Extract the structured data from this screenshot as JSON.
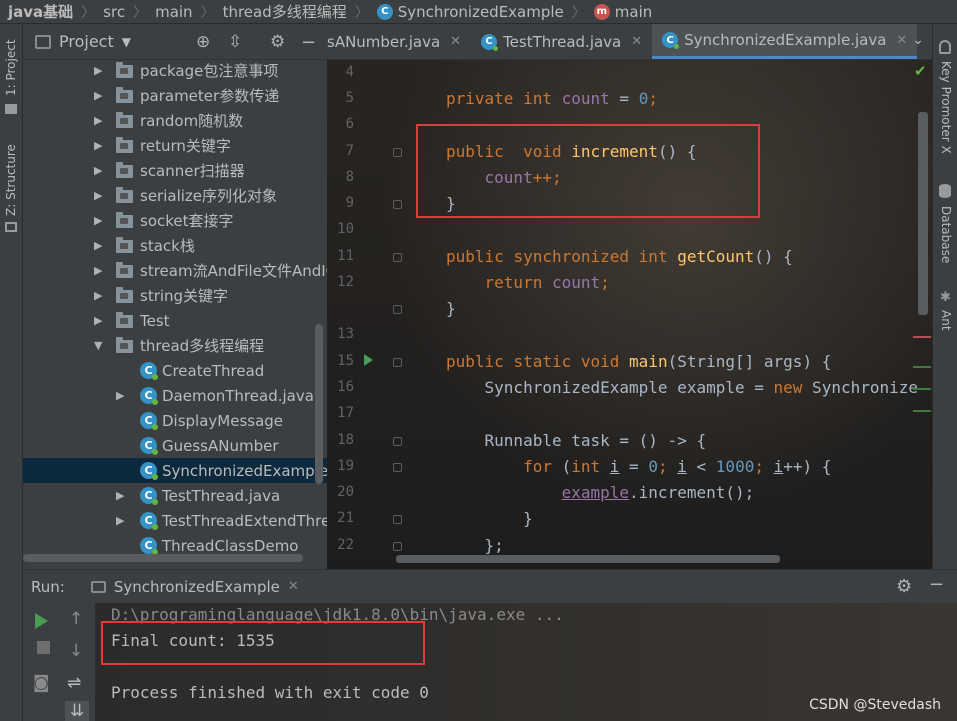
{
  "breadcrumb": {
    "items": [
      "java基础",
      "src",
      "main",
      "thread多线程编程",
      "SynchronizedExample",
      "main"
    ]
  },
  "left_stripe": {
    "project": "1: Project",
    "structure": "Z: Structure"
  },
  "right_stripe": {
    "key_promoter": "Key Promoter X",
    "database": "Database",
    "ant": "Ant"
  },
  "project_panel": {
    "title": "Project",
    "tree": [
      {
        "label": "package包注意事项",
        "type": "folder",
        "expandable": true
      },
      {
        "label": "parameter参数传递",
        "type": "folder",
        "expandable": true
      },
      {
        "label": "random随机数",
        "type": "folder",
        "expandable": true
      },
      {
        "label": "return关键字",
        "type": "folder",
        "expandable": true
      },
      {
        "label": "scanner扫描器",
        "type": "folder",
        "expandable": true
      },
      {
        "label": "serialize序列化对象",
        "type": "folder",
        "expandable": true
      },
      {
        "label": "socket套接字",
        "type": "folder",
        "expandable": true
      },
      {
        "label": "stack栈",
        "type": "folder",
        "expandable": true
      },
      {
        "label": "stream流AndFile文件AndIO",
        "type": "folder",
        "expandable": true
      },
      {
        "label": "string关键字",
        "type": "folder",
        "expandable": true
      },
      {
        "label": "Test",
        "type": "folder",
        "expandable": true
      },
      {
        "label": "thread多线程编程",
        "type": "folder",
        "expanded": true
      },
      {
        "label": "CreateThread",
        "type": "class"
      },
      {
        "label": "DaemonThread.java",
        "type": "class",
        "expandable": true
      },
      {
        "label": "DisplayMessage",
        "type": "class"
      },
      {
        "label": "GuessANumber",
        "type": "class"
      },
      {
        "label": "SynchronizedExample",
        "type": "class",
        "selected": true
      },
      {
        "label": "TestThread.java",
        "type": "class",
        "expandable": true
      },
      {
        "label": "TestThreadExtendThread",
        "type": "class",
        "expandable": true
      },
      {
        "label": "ThreadClassDemo",
        "type": "class"
      }
    ]
  },
  "editor_tabs": [
    {
      "label": "sANumber.java",
      "active": false
    },
    {
      "label": "TestThread.java",
      "active": false
    },
    {
      "label": "SynchronizedExample.java",
      "active": true
    }
  ],
  "editor": {
    "line_numbers": [
      "4",
      "5",
      "6",
      "7",
      "8",
      "9",
      "10",
      "11",
      "12",
      "13",
      "15",
      "16",
      "17",
      "18",
      "19",
      "20",
      "21",
      "22"
    ],
    "code": {
      "l5": [
        "private",
        "int",
        "count",
        "0"
      ],
      "l7": [
        "public",
        "void",
        "increment",
        "() {"
      ],
      "l8": [
        "count",
        "++;"
      ],
      "l9": "}",
      "l11": [
        "public",
        "synchronized",
        "int",
        "getCount",
        "() {"
      ],
      "l12": [
        "return",
        "count",
        ";"
      ],
      "l13": "}",
      "l15": [
        "public",
        "static",
        "void",
        "main",
        "(String[] args) {"
      ],
      "l16": [
        "SynchronizedExample example = ",
        "new",
        " Synchronize"
      ],
      "l18": "Runnable task = () -> {",
      "l19": [
        "for",
        "int",
        "i",
        "0",
        "i",
        "1000",
        "i"
      ],
      "l20": [
        "example",
        ".increment();"
      ],
      "l21": "}",
      "l22": "};"
    }
  },
  "run_panel": {
    "label": "Run:",
    "tab": "SynchronizedExample",
    "console": [
      "D:\\programinglanguage\\jdk1.8.0\\bin\\java.exe ...",
      "Final count: 1535",
      "",
      "Process finished with exit code 0"
    ],
    "watermark": "CSDN @Stevedash"
  },
  "colors": {
    "keyword": "#cc7832",
    "number": "#6897bb",
    "function": "#ffc66d",
    "field": "#9876aa",
    "highlight_box": "#e03a3a",
    "run_green": "#499c54"
  }
}
